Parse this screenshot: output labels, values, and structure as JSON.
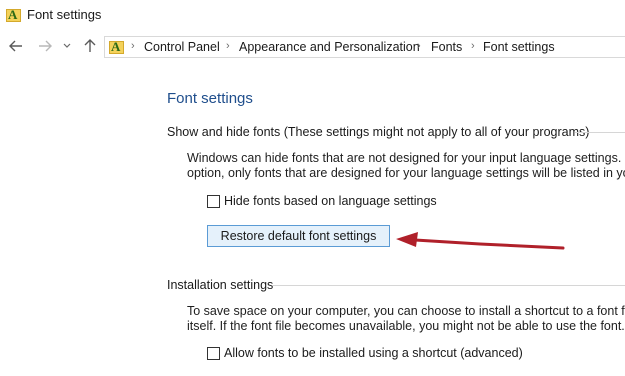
{
  "window": {
    "title": "Font settings",
    "app_icon": "fonts-folder-icon",
    "app_icon_letter": "A"
  },
  "navigation": {
    "back_icon": "back-arrow-icon",
    "forward_icon": "forward-arrow-icon",
    "recent_icon": "chevron-down-icon",
    "up_icon": "up-arrow-icon",
    "breadcrumbs": [
      "Control Panel",
      "Appearance and Personalization",
      "Fonts",
      "Font settings"
    ]
  },
  "page": {
    "heading": "Font settings",
    "show_hide_section": {
      "title": "Show and hide fonts (These settings might not apply to all of your programs)",
      "description_lines": [
        "Windows can hide fonts that are not designed for your input language settings. If yo",
        "option, only fonts that are designed for your language settings will be listed in your"
      ],
      "checkbox_label": "Hide fonts based on language settings",
      "checkbox_checked": false,
      "restore_button_label": "Restore default font settings"
    },
    "installation_section": {
      "title": "Installation settings",
      "description_lines": [
        "To save space on your computer, you can choose to install a shortcut to a font file i",
        "itself. If the font file becomes unavailable, you might not be able to use the font."
      ],
      "checkbox_label": "Allow fonts to be installed using a shortcut (advanced)",
      "checkbox_checked": false
    }
  },
  "annotation": {
    "arrow_color": "#b0202a"
  }
}
